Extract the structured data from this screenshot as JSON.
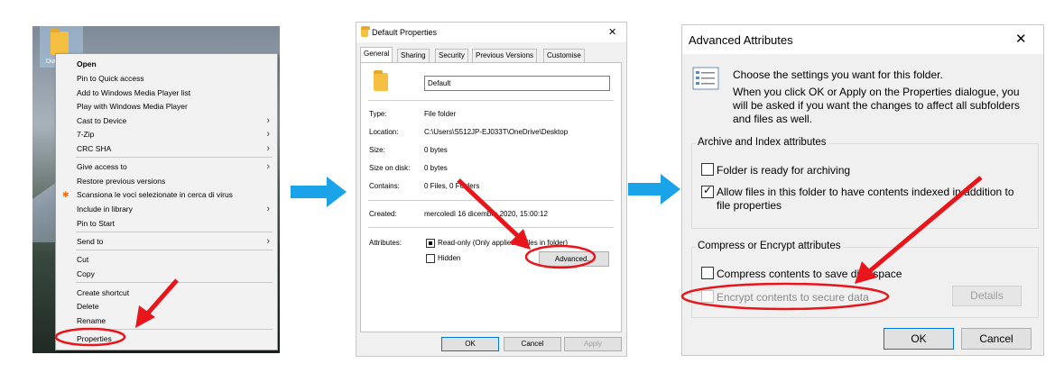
{
  "context_menu": {
    "desktop_folder_label": "Dia",
    "items": [
      {
        "label": "Open",
        "bold": true,
        "submenu": false
      },
      {
        "label": "Pin to Quick access",
        "submenu": false
      },
      {
        "label": "Add to Windows Media Player list",
        "submenu": false
      },
      {
        "label": "Play with Windows Media Player",
        "submenu": false
      },
      {
        "label": "Cast to Device",
        "submenu": true
      },
      {
        "label": "7-Zip",
        "submenu": true
      },
      {
        "label": "CRC SHA",
        "submenu": true
      },
      {
        "label": "Give access to",
        "submenu": true
      },
      {
        "label": "Restore previous versions",
        "submenu": false
      },
      {
        "label": "Scansiona le voci selezionate in cerca di virus",
        "submenu": false
      },
      {
        "label": "Include in library",
        "submenu": true
      },
      {
        "label": "Pin to Start",
        "submenu": false
      },
      {
        "label": "Send to",
        "submenu": true
      },
      {
        "label": "Cut",
        "submenu": false
      },
      {
        "label": "Copy",
        "submenu": false
      },
      {
        "label": "Create shortcut",
        "submenu": false
      },
      {
        "label": "Delete",
        "submenu": false
      },
      {
        "label": "Rename",
        "submenu": false
      },
      {
        "label": "Properties",
        "submenu": false
      }
    ]
  },
  "properties_dialog": {
    "title": "Default Properties",
    "close_glyph": "✕",
    "tabs": [
      "General",
      "Sharing",
      "Security",
      "Previous Versions",
      "Customise"
    ],
    "active_tab": "General",
    "folder_name": "Default",
    "rows": {
      "type_label": "Type:",
      "type_value": "File folder",
      "location_label": "Location:",
      "location_value": "C:\\Users\\S512JP-EJ033T\\OneDrive\\Desktop",
      "size_label": "Size:",
      "size_value": "0 bytes",
      "size_on_disk_label": "Size on disk:",
      "size_on_disk_value": "0 bytes",
      "contains_label": "Contains:",
      "contains_value": "0 Files, 0 Folders",
      "created_label": "Created:",
      "created_value": "mercoledì 16 dicembre 2020, 15:00:12",
      "attributes_label": "Attributes:"
    },
    "readonly_label": "Read-only (Only applies to files in folder)",
    "hidden_label": "Hidden",
    "advanced_button": "Advanced...",
    "ok_button": "OK",
    "cancel_button": "Cancel",
    "apply_button": "Apply"
  },
  "advanced_dialog": {
    "title": "Advanced Attributes",
    "close_glyph": "✕",
    "intro_line1": "Choose the settings you want for this folder.",
    "intro_line2": "When you click OK or Apply on the Properties dialogue, you will be asked if you want the changes to affect all subfolders and files as well.",
    "archive_group_title": "Archive and Index attributes",
    "archive_checkbox": "Folder is ready for archiving",
    "index_checkbox": "Allow files in this folder to have contents indexed in addition to file properties",
    "compress_group_title": "Compress or Encrypt attributes",
    "compress_checkbox": "Compress contents to save disk space",
    "encrypt_checkbox": "Encrypt contents to secure data",
    "details_button": "Details",
    "ok_button": "OK",
    "cancel_button": "Cancel"
  },
  "colors": {
    "arrow_blue": "#1aa3e8",
    "annotation_red": "#e8151b",
    "focus_blue": "#0078d7"
  }
}
